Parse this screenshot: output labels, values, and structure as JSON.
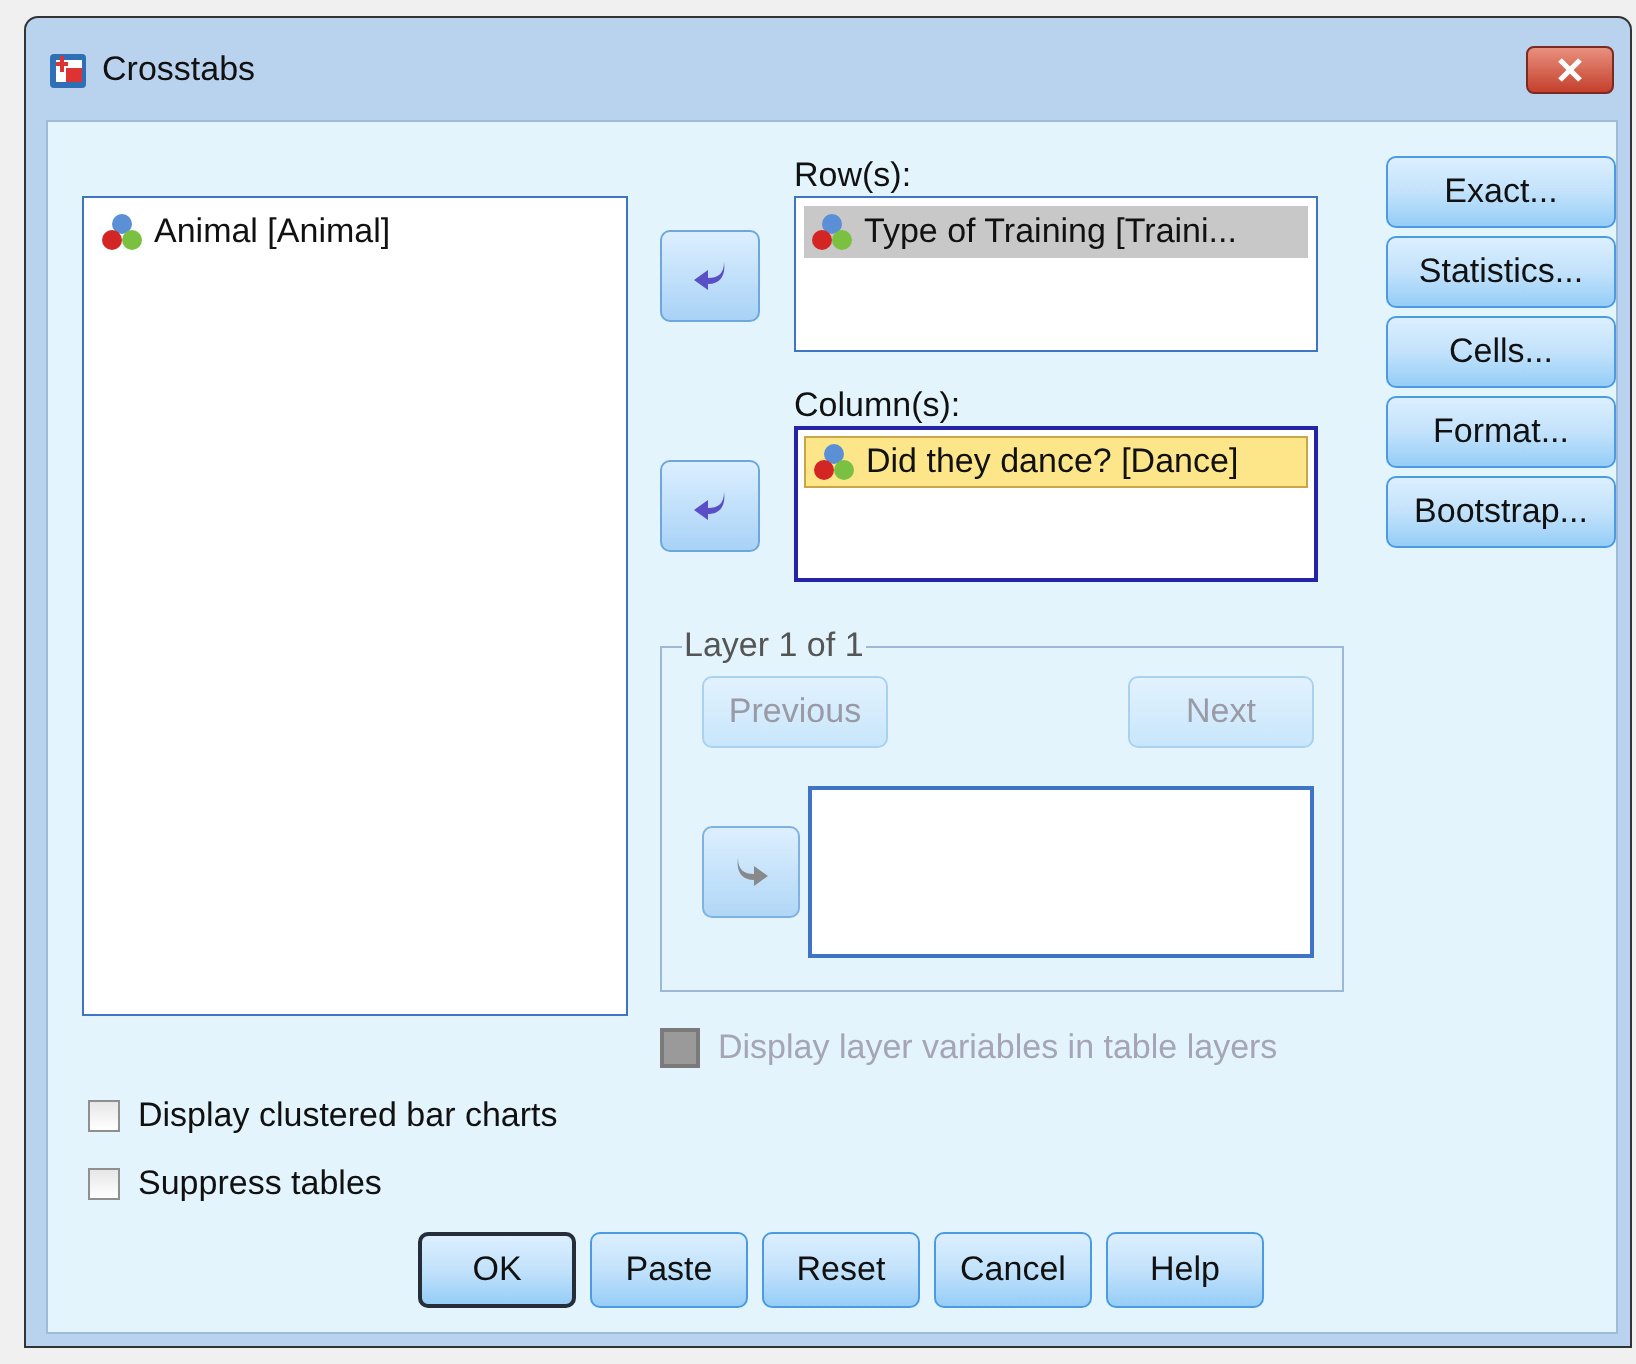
{
  "window": {
    "title": "Crosstabs"
  },
  "source_list": {
    "items": [
      {
        "label": "Animal [Animal]",
        "selected": false
      }
    ]
  },
  "target_lists": [
    {
      "label": "Row(s):",
      "focused": false,
      "items": [
        {
          "label": "Type of Training [Traini...",
          "selected": true
        }
      ]
    },
    {
      "label": "Column(s):",
      "focused": true,
      "items": [
        {
          "label": "Did they dance? [Dance]",
          "selected": true
        }
      ]
    }
  ],
  "side_buttons": [
    "Exact...",
    "Statistics...",
    "Cells...",
    "Format...",
    "Bootstrap..."
  ],
  "layer": {
    "title": "Layer 1 of 1",
    "buttons": [
      {
        "label": "Previous",
        "disabled": true
      },
      {
        "label": "Next",
        "disabled": true
      }
    ],
    "arrow_disabled": true
  },
  "layer_option": {
    "label": "Display layer variables in table layers",
    "checked": false,
    "disabled": true
  },
  "options": [
    {
      "label": "Display clustered bar charts",
      "checked": false
    },
    {
      "label": "Suppress tables",
      "checked": false
    }
  ],
  "buttons": [
    {
      "label": "OK",
      "default": true
    },
    {
      "label": "Paste",
      "default": false
    },
    {
      "label": "Reset",
      "default": false
    },
    {
      "label": "Cancel",
      "default": false
    },
    {
      "label": "Help",
      "default": false
    }
  ]
}
